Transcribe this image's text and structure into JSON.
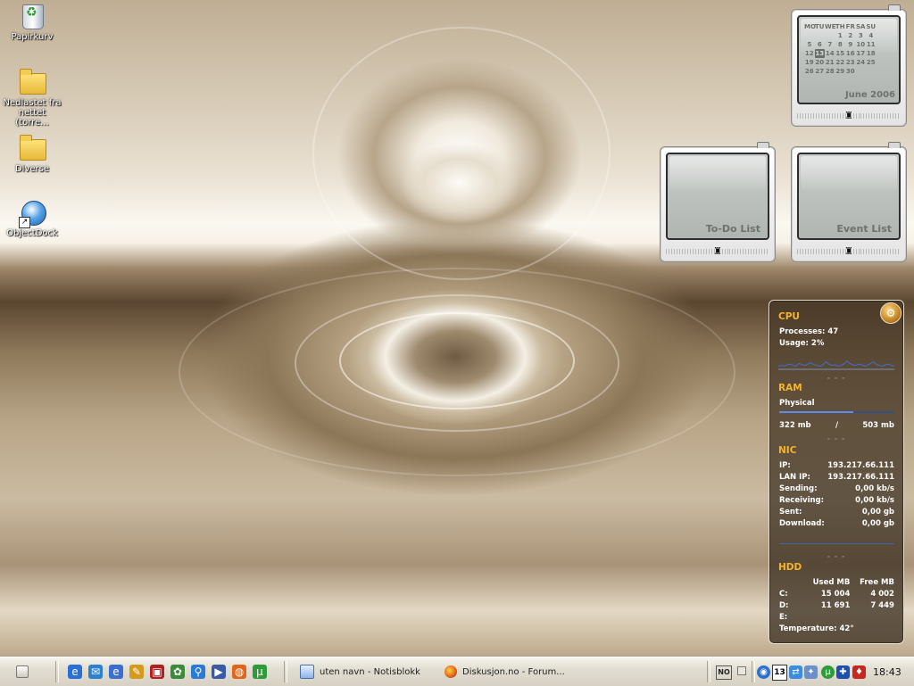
{
  "desktop": {
    "icons": [
      {
        "label": "Papirkurv",
        "icon": "recycle-bin-icon"
      },
      {
        "label": "Nedlastet fra nettet (torre...",
        "icon": "folder-icon"
      },
      {
        "label": "Diverse",
        "icon": "folder-icon"
      },
      {
        "label": "ObjectDock",
        "icon": "objectdock-shortcut-icon"
      }
    ]
  },
  "calendar": {
    "weekdays": [
      "MO",
      "TU",
      "WE",
      "TH",
      "FR",
      "SA",
      "SU"
    ],
    "weeks": [
      [
        "",
        "",
        "",
        "1",
        "2",
        "3",
        "4"
      ],
      [
        "5",
        "6",
        "7",
        "8",
        "9",
        "10",
        "11"
      ],
      [
        "12",
        "13",
        "14",
        "15",
        "16",
        "17",
        "18"
      ],
      [
        "19",
        "20",
        "21",
        "22",
        "23",
        "24",
        "25"
      ],
      [
        "26",
        "27",
        "28",
        "29",
        "30",
        "",
        ""
      ]
    ],
    "today": "13",
    "month_label": "June 2006"
  },
  "todo_gadget": {
    "label": "To-Do List"
  },
  "event_gadget": {
    "label": "Event List"
  },
  "sysmon": {
    "cpu": {
      "title": "CPU",
      "processes_label": "Processes:",
      "processes": "47",
      "usage_label": "Usage:",
      "usage": "2%"
    },
    "ram": {
      "title": "RAM",
      "physical_label": "Physical",
      "used": "322 mb",
      "separator": "/",
      "total": "503 mb",
      "fill": 0.64
    },
    "nic": {
      "title": "NIC",
      "rows": [
        {
          "label": "IP:",
          "value": "193.217.66.111"
        },
        {
          "label": "LAN IP:",
          "value": "193.217.66.111"
        },
        {
          "label": "Sending:",
          "value": "0,00 kb/s"
        },
        {
          "label": "Receiving:",
          "value": "0,00 kb/s"
        },
        {
          "label": "Sent:",
          "value": "0,00 gb"
        },
        {
          "label": "Download:",
          "value": "0,00 gb"
        }
      ]
    },
    "hdd": {
      "title": "HDD",
      "col_used": "Used MB",
      "col_free": "Free MB",
      "rows": [
        {
          "drive": "C:",
          "used": "15 004",
          "free": "4 002"
        },
        {
          "drive": "D:",
          "used": "11 691",
          "free": "7 449"
        },
        {
          "drive": "E:",
          "used": "",
          "free": ""
        }
      ],
      "temperature": "Temperature: 42°"
    },
    "cpu_graph": [
      3,
      4,
      3,
      5,
      6,
      4,
      3,
      7,
      5,
      4,
      6,
      8,
      5,
      4,
      3,
      5,
      9,
      6,
      4,
      5,
      3,
      4,
      6,
      10,
      7,
      5,
      4,
      6,
      5,
      3,
      4,
      7,
      9,
      5,
      4,
      3,
      5,
      6,
      4,
      3
    ]
  },
  "taskbar": {
    "quick_launch": [
      "internet-explorer-icon",
      "outlook-icon",
      "ie-alt-icon",
      "tool-icon",
      "media-icon",
      "messenger-icon",
      "network-icon",
      "media-player-icon",
      "firefox-icon",
      "utorrent-icon"
    ],
    "tasks": [
      {
        "label": "uten navn - Notisblokk",
        "icon": "notepad-icon"
      },
      {
        "label": "Diskusjon.no - Forum...",
        "icon": "firefox-icon"
      }
    ],
    "lang": "NO",
    "tray_calendar_day": "13",
    "clock": "18:43"
  }
}
